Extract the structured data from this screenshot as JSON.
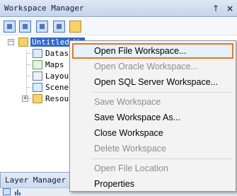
{
  "panel": {
    "title": "Workspace Manager",
    "pin_glyph": "↑",
    "close_glyph": "×",
    "toolbar_icons": [
      "datasource-icon",
      "map-icon",
      "layout-icon",
      "scene-icon",
      "folder-icon"
    ]
  },
  "tree": {
    "root": {
      "label": "Untitled Wo",
      "expander": "−",
      "icon": "workspace-icon"
    },
    "children": [
      {
        "label": "Datas",
        "icon": "datasources-icon"
      },
      {
        "label": "Maps",
        "icon": "maps-icon"
      },
      {
        "label": "Layou",
        "icon": "layouts-icon"
      },
      {
        "label": "Scene",
        "icon": "scenes-icon"
      },
      {
        "label": "Resou",
        "icon": "resources-icon",
        "expander": "+"
      }
    ]
  },
  "context_menu": {
    "items": [
      {
        "label": "Open File Workspace...",
        "disabled": false,
        "hover": true
      },
      {
        "label": "Open Oracle Workspace...",
        "disabled": true
      },
      {
        "label": "Open SQL Server Workspace...",
        "disabled": false
      },
      {
        "label": "Save Workspace",
        "disabled": true
      },
      {
        "label": "Save Workspace As...",
        "disabled": false
      },
      {
        "label": "Close Workspace",
        "disabled": false
      },
      {
        "label": "Delete Workspace",
        "disabled": true
      },
      {
        "label": "Open File Location",
        "disabled": true
      },
      {
        "label": "Properties",
        "disabled": false
      }
    ]
  },
  "layer_manager": {
    "title": "Layer Manager"
  },
  "colors": {
    "selection": "#3169c6",
    "hover_outline": "#e8742a",
    "hover_fill": "#e5f1fb",
    "disabled_text": "#8d8d8d"
  }
}
